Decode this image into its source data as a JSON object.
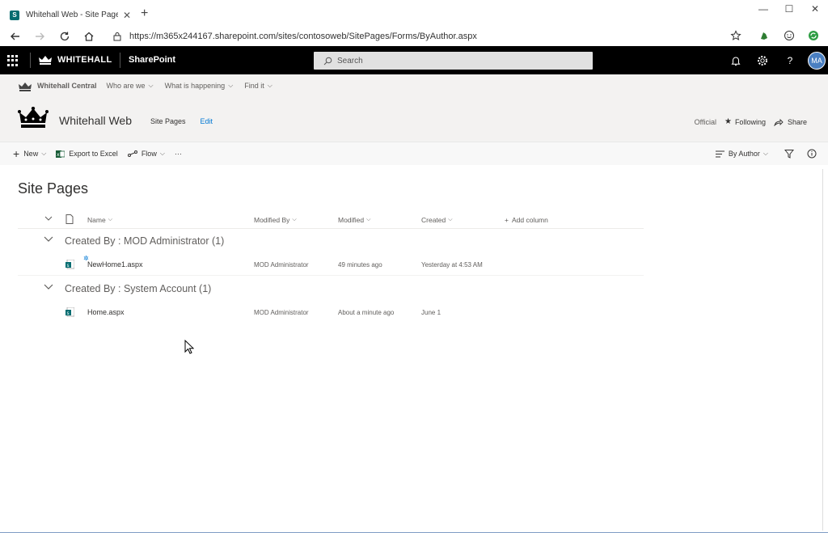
{
  "browser": {
    "tab_title": "Whitehall Web - Site Pages - By",
    "url": "https://m365x244167.sharepoint.com/sites/contosoweb/SitePages/Forms/ByAuthor.aspx"
  },
  "suitebar": {
    "org": "WHITEHALL",
    "app": "SharePoint",
    "search_placeholder": "Search",
    "avatar_initials": "MA"
  },
  "hubnav": {
    "name": "Whitehall Central",
    "items": [
      "Who are we",
      "What is happening",
      "Find it"
    ]
  },
  "site": {
    "title": "Whitehall Web",
    "nav": [
      "Site Pages",
      "Edit"
    ],
    "classification": "Official",
    "following": "Following",
    "share": "Share"
  },
  "commands": {
    "new": "New",
    "export": "Export to Excel",
    "flow": "Flow",
    "more": "···",
    "view": "By Author"
  },
  "list": {
    "title": "Site Pages",
    "columns": [
      "Name",
      "Modified By",
      "Modified",
      "Created",
      "Add column"
    ],
    "groups": [
      {
        "title": "Created By : MOD Administrator (1)",
        "rows": [
          {
            "name": "NewHome1.aspx",
            "modified_by": "MOD Administrator",
            "modified": "49 minutes ago",
            "created": "Yesterday at 4:53 AM"
          }
        ]
      },
      {
        "title": "Created By : System Account (1)",
        "rows": [
          {
            "name": "Home.aspx",
            "modified_by": "MOD Administrator",
            "modified": "About a minute ago",
            "created": "June 1"
          }
        ]
      }
    ]
  },
  "colors": {
    "suitebar": "#000000",
    "accent": "#0078d4",
    "sharepoint_teal": "#036c70"
  }
}
